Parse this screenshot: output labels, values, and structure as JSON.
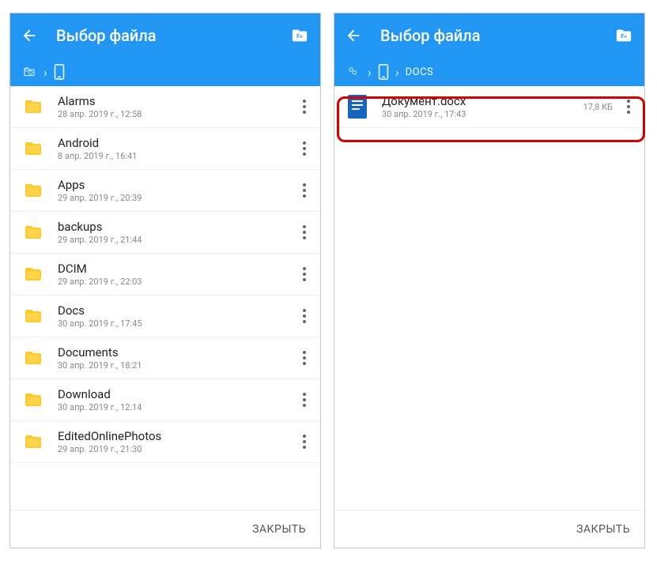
{
  "left": {
    "title": "Выбор файла",
    "breadcrumb": [],
    "items": [
      {
        "name": "Alarms",
        "date": "28 апр. 2019 г., 12:58"
      },
      {
        "name": "Android",
        "date": "8 апр. 2019 г., 16:41"
      },
      {
        "name": "Apps",
        "date": "29 апр. 2019 г., 20:39"
      },
      {
        "name": "backups",
        "date": "29 апр. 2019 г., 21:44"
      },
      {
        "name": "DCIM",
        "date": "29 апр. 2019 г., 22:03"
      },
      {
        "name": "Docs",
        "date": "30 апр. 2019 г., 17:45"
      },
      {
        "name": "Documents",
        "date": "30 апр. 2019 г., 18:21"
      },
      {
        "name": "Download",
        "date": "30 апр. 2019 г., 12:14"
      },
      {
        "name": "EditedOnlinePhotos",
        "date": "29 апр. 2019 г., 21:30"
      }
    ],
    "close": "ЗАКРЫТЬ"
  },
  "right": {
    "title": "Выбор файла",
    "breadcrumb_label": "DOCS",
    "items": [
      {
        "name": "Документ.docx",
        "date": "30 апр. 2019 г., 17:43",
        "size": "17,8 КБ"
      }
    ],
    "close": "ЗАКРЫТЬ"
  },
  "colors": {
    "accent": "#2196f3",
    "folder": "#ffca28",
    "doc": "#1565c0"
  }
}
